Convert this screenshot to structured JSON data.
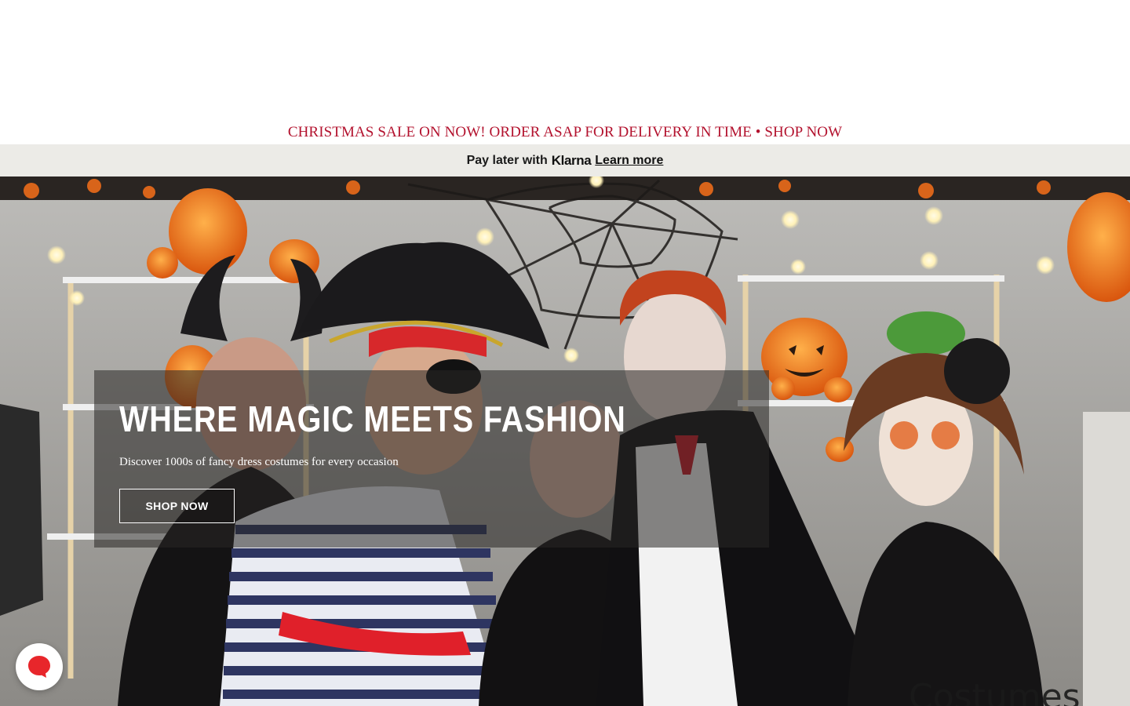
{
  "promo": {
    "text": "CHRISTMAS SALE ON NOW! ORDER ASAP FOR DELIVERY IN TIME • SHOP NOW",
    "color": "#b3122e"
  },
  "klarna": {
    "prefix": "Pay later with",
    "brand": "Klarna",
    "link": "Learn more"
  },
  "hero": {
    "title": "WHERE MAGIC MEETS FASHION",
    "subtitle": "Discover 1000s of fancy dress costumes for every occasion",
    "cta": "SHOP NOW",
    "image_description_icon": "halloween-costume-kids-photo",
    "corner_text": "Costumes"
  },
  "chat": {
    "icon": "chat-bubble-icon",
    "color": "#e8262b"
  }
}
